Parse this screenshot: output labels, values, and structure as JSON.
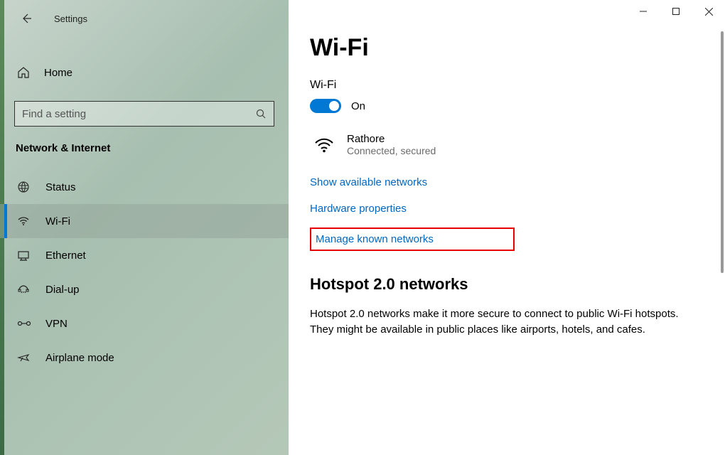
{
  "titlebar": {
    "app_name": "Settings"
  },
  "sidebar": {
    "home_label": "Home",
    "search_placeholder": "Find a setting",
    "category": "Network & Internet",
    "items": [
      {
        "label": "Status",
        "icon": "status-icon"
      },
      {
        "label": "Wi-Fi",
        "icon": "wifi-icon"
      },
      {
        "label": "Ethernet",
        "icon": "ethernet-icon"
      },
      {
        "label": "Dial-up",
        "icon": "dialup-icon"
      },
      {
        "label": "VPN",
        "icon": "vpn-icon"
      },
      {
        "label": "Airplane mode",
        "icon": "airplane-icon"
      }
    ],
    "selected_index": 1
  },
  "main": {
    "page_title": "Wi-Fi",
    "wifi": {
      "section_label": "Wi-Fi",
      "toggle_on": true,
      "toggle_label": "On",
      "network_name": "Rathore",
      "network_status": "Connected, secured"
    },
    "links": {
      "show_available": "Show available networks",
      "hardware_props": "Hardware properties",
      "manage_known": "Manage known networks"
    },
    "hotspot": {
      "heading": "Hotspot 2.0 networks",
      "body": "Hotspot 2.0 networks make it more secure to connect to public Wi-Fi hotspots. They might be available in public places like airports, hotels, and cafes."
    }
  },
  "colors": {
    "accent": "#0078d4",
    "link": "#0067c0",
    "highlight": "#e60000"
  }
}
